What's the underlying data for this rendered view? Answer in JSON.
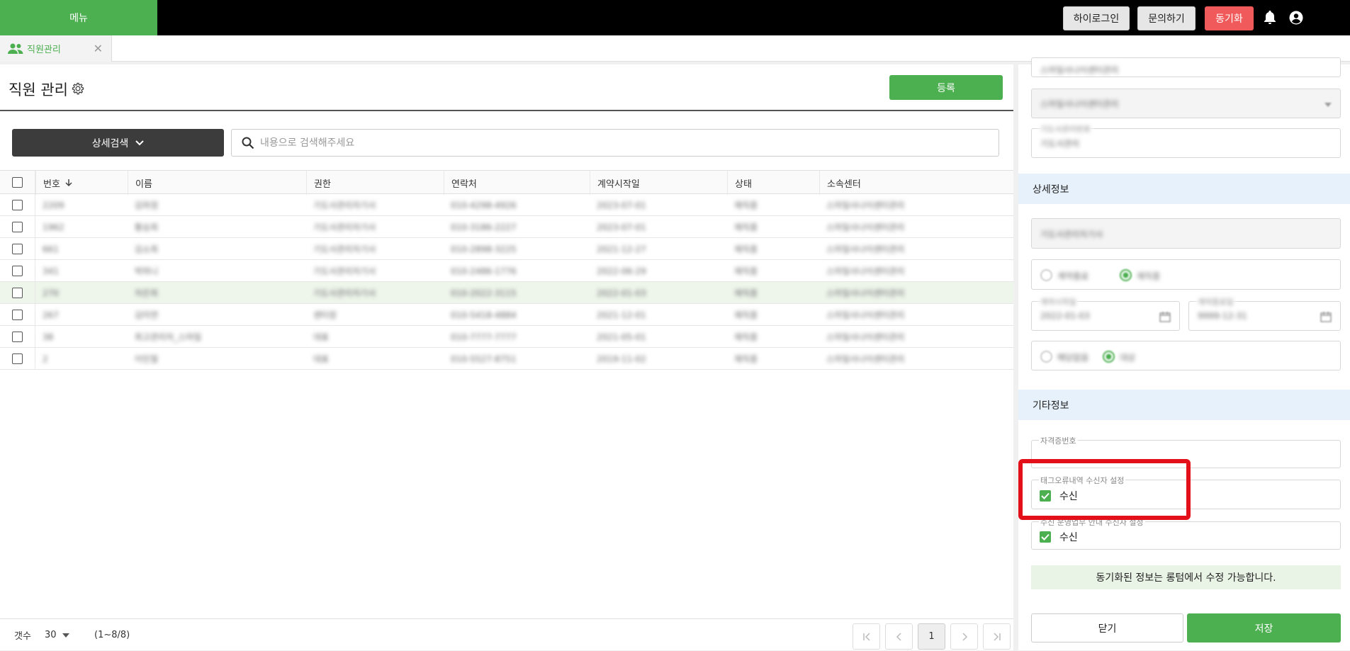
{
  "topbar": {
    "menu_label": "메뉴",
    "hilogin_label": "하이로그인",
    "inquiry_label": "문의하기",
    "sync_label": "동기화",
    "accent": "#4caf50",
    "sync_color": "#f05a5a"
  },
  "tab": {
    "label": "직원관리"
  },
  "page": {
    "title": "직원 관리",
    "register_label": "등록",
    "detail_search_label": "상세검색",
    "search_placeholder": "내용으로 검색해주세요"
  },
  "table": {
    "columns": [
      "번호",
      "이름",
      "권한",
      "연락처",
      "계약시작일",
      "상태",
      "소속센터"
    ],
    "rows": [
      [
        "2209",
        "김하정",
        "기도사관리자기사",
        "010-4298-4926",
        "2023-07-01",
        "재직중",
        "스마일사나이센터관리"
      ],
      [
        "1962",
        "황승희",
        "기도사관리자기사",
        "010-3186-2227",
        "2023-07-01",
        "재직중",
        "스마일사나이센터관리"
      ],
      [
        "661",
        "김소희",
        "기도사관리자기사",
        "010-2898-3225",
        "2021-12-27",
        "재직중",
        "스마일사나이센터관리"
      ],
      [
        "341",
        "박하니",
        "기도사관리자기사",
        "010-2486-1776",
        "2022-06-29",
        "재직중",
        "스마일사나이센터관리"
      ],
      [
        "270",
        "차은희",
        "기도사관리자기사",
        "010-2022-3115",
        "2022-01-03",
        "재직중",
        "스마일사나이센터관리"
      ],
      [
        "267",
        "김미연",
        "센터장",
        "010-5418-4884",
        "2021-12-01",
        "재직중",
        "스마일사나이센터관리"
      ],
      [
        "38",
        "최고관리자_스마일",
        "대표",
        "010-7777-7777",
        "2021-05-01",
        "재직중",
        "스마일사나이센터관리"
      ],
      [
        "2",
        "이민철",
        "대표",
        "010-5527-8751",
        "2019-11-02",
        "재직중",
        "스마일사나이센터관리"
      ]
    ],
    "highlight_row": 4
  },
  "footer": {
    "count_label": "갯수",
    "page_size": "30",
    "range_text": "(1~8/8)",
    "current_page": "1"
  },
  "panel": {
    "blur_field_1": "스마일사나이센터관리",
    "blur_field_2": "스마일사나이센터관리",
    "blur_field_3": "기도사관리",
    "blur_field_3_label": "기도사관리번호",
    "section_detail": "상세정보",
    "blur_role": "기도사관리자기사",
    "blur_status_a": "계약종료",
    "blur_status_b": "재직중",
    "blur_start_label": "계약시작일",
    "blur_start": "2022-01-03",
    "blur_end_label": "계약종료일",
    "blur_end": "9999-12-31",
    "blur_opt_a": "해당없음",
    "blur_opt_b": "대상",
    "section_other": "기타정보",
    "cert_label": "자격증번호",
    "tag_error_label": "태그오류내역 수신자 설정",
    "tag_error_value": "수신",
    "notice_label": "수신 운영업무 안내 수신자 설정",
    "notice_value": "수신",
    "sync_note": "동기화된 정보는 롱텀에서 수정 가능합니다.",
    "close_label": "닫기",
    "save_label": "저장"
  }
}
